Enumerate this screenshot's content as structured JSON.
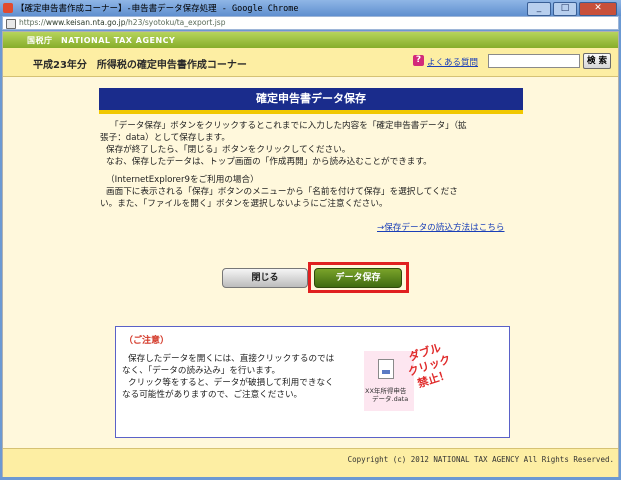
{
  "window": {
    "title": "【確定申告書作成コーナー】-申告書データ保存処理 - Google Chrome",
    "buttons": {
      "minimize": "_",
      "maximize": "□",
      "close": "✕"
    }
  },
  "address_bar": {
    "scheme": "https://",
    "host": "www.keisan.nta.go.jp",
    "path": "/h23/syotoku/ta_export.jsp"
  },
  "header": {
    "agency": "国税庁　NATIONAL TAX AGENCY",
    "corner_title": "平成23年分　所得税の確定申告書作成コーナー",
    "faq_icon": "?",
    "faq_link": "よくある質問",
    "search_placeholder": "",
    "search_button": "検 索"
  },
  "main": {
    "heading": "確定申告書データ保存",
    "para1_line1": "「データ保存」ボタンをクリックするとこれまでに入力した内容を「確定申告書データ」（拡",
    "para1_line2": "張子：data）として保存します。",
    "para1_line3": "保存が終了したら、「閉じる」ボタンをクリックしてください。",
    "para1_line4": "なお、保存したデータは、トップ画面の「作成再開」から読み込むことができます。",
    "para2_line1": "（InternetExplorer9をご利用の場合）",
    "para2_line2": "画面下に表示される「保存」ボタンのメニューから「名前を付けて保存」を選択してくださ",
    "para2_line3": "い。また、「ファイルを開く」ボタンを選択しないようにご注意ください。",
    "load_link": "→保存データの読込方法はこちら",
    "close_button": "閉じる",
    "save_button": "データ保存"
  },
  "notice": {
    "title": "（ご注意）",
    "line1": "保存したデータを開くには、直接クリックするのでは",
    "line2": "なく、「データの読み込み」を行います。",
    "line3": "クリック等をすると、データが破損して利用できなく",
    "line4": "なる可能性がありますので、ご注意ください。",
    "file_label1": "XX年所得申告",
    "file_label2": "データ.data",
    "stamp_line1": "ダブル",
    "stamp_line2": "クリック",
    "stamp_line3": "禁止！"
  },
  "footer": {
    "copyright": "Copyright (c) 2012 NATIONAL TAX AGENCY All Rights Reserved."
  },
  "colors": {
    "heading_bg": "#1a2c8c",
    "save_button": "#4f7a18",
    "highlight": "#e02020",
    "page_bg": "#fff8dc"
  }
}
